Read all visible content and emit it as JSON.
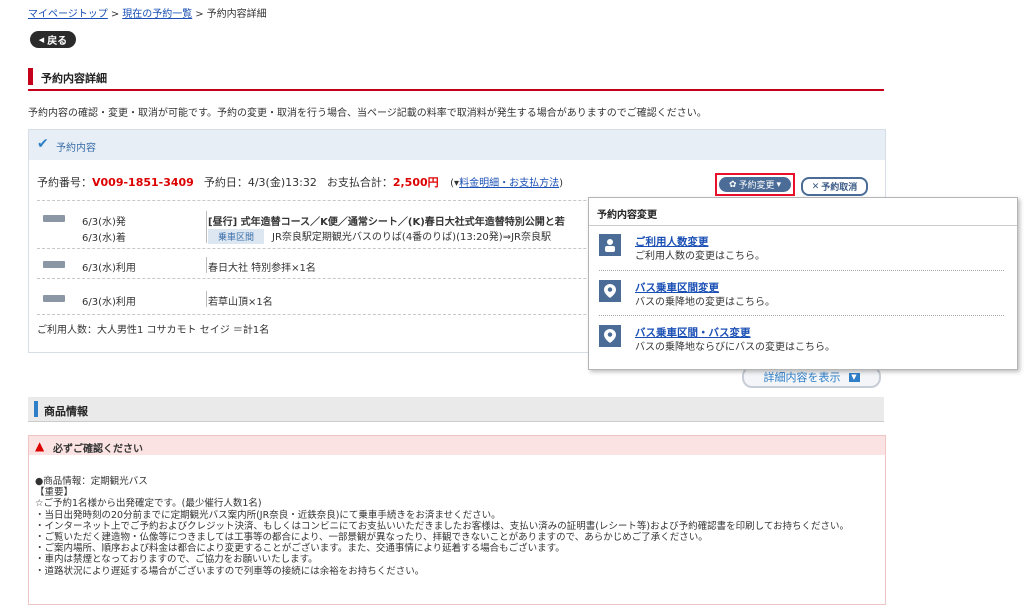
{
  "breadcrumb": {
    "items": [
      {
        "label": "マイページトップ",
        "link": true
      },
      {
        "label": "現在の予約一覧",
        "link": true
      },
      {
        "label": "予約内容詳細",
        "link": false
      }
    ],
    "separator": ">"
  },
  "back_button": {
    "label": "戻る"
  },
  "page_title": "予約内容詳細",
  "intro_text": "予約内容の確認・変更・取消が可能です。予約の変更・取消を行う場合、当ページ記載の料率で取消料が発生する場合がありますのでご確認ください。",
  "reservation": {
    "header": "予約内容",
    "number_label": "予約番号：",
    "number": "V009-1851-3409",
    "date_label": "予約日：",
    "date": "4/3(金)13:32",
    "total_label": "お支払合計：",
    "total": "2,500円",
    "fee_link": "料金明細・お支払方法",
    "change_button": "予約変更",
    "cancel_button": "予約取消",
    "rows": [
      {
        "date1": "6/3(水)発",
        "date2": "6/3(水)着",
        "title": "[昼行] 式年造替コース／K便／通常シート／(K)春日大社式年造替特別公開と若",
        "chip": "乗車区間",
        "route": "JR奈良駅定期観光バスのりば(4番のりば)(13:20発)⇒JR奈良駅"
      },
      {
        "date1": "6/3(水)利用",
        "desc": "春日大社 特別参拝×1名"
      },
      {
        "date1": "6/3(水)利用",
        "desc": "若草山頂×1名"
      }
    ],
    "users": "ご利用人数：大人男性1 コサカモト セイジ ＝計1名"
  },
  "detail_button": "詳細内容を表示",
  "product": {
    "title": "商品情報",
    "notice_title": "必ずご確認ください",
    "lines": [
      "●商品情報：定期観光バス",
      "【重要】",
      "☆ご予約1名様から出発確定です。(最少催行人数1名)",
      "・当日出発時刻の20分前までに定期観光バス案内所(JR奈良・近鉄奈良)にて乗車手続きをお済ませください。",
      "・インターネット上でご予約およびクレジット決済、もしくはコンビニにてお支払いいただきましたお客様は、支払い済みの証明書(レシート等)および予約確認書を印刷してお持ちください。",
      "・ご覧いただく建造物・仏像等につきましては工事等の都合により、一部景観が異なったり、拝観できないことがありますので、あらかじめご了承ください。",
      "・ご案内場所、順序および料金は都合により変更することがございます。また、交通事情により延着する場合もございます。",
      "・車内は禁煙となっておりますので、ご協力をお願いいたします。",
      "・道路状況により遅延する場合がございますので列車等の接続には余裕をお持ちください。"
    ]
  },
  "popup": {
    "title": "予約内容変更",
    "items": [
      {
        "icon": "person-icon",
        "title": "ご利用人数変更",
        "sub": "ご利用人数の変更はこちら。"
      },
      {
        "icon": "location-pin-icon",
        "title": "バス乗車区間変更",
        "sub": "バスの乗降地の変更はこちら。"
      },
      {
        "icon": "location-pin-icon",
        "title": "バス乗車区間・バス変更",
        "sub": "バスの乗降地ならびにバスの変更はこちら。"
      }
    ]
  }
}
